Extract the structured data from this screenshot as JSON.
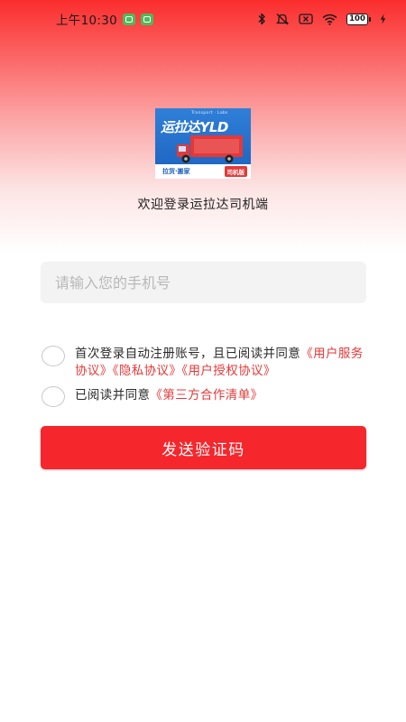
{
  "status_bar": {
    "time": "上午10:30",
    "battery": "100"
  },
  "logo": {
    "title": "运拉达YLD",
    "subtitle": "Transport · Labs",
    "bottom_text": "拉货·搬家",
    "badge": "司机版"
  },
  "welcome_text": "欢迎登录运拉达司机端",
  "phone_input": {
    "placeholder": "请输入您的手机号",
    "value": ""
  },
  "agreement1": {
    "text": "首次登录自动注册账号，且已阅读并同意",
    "link_user_service": "《用户服务协议》",
    "link_privacy": "《隐私协议》",
    "link_auth": "《用户授权协议》"
  },
  "agreement2": {
    "text": "已阅读并同意",
    "link_third_party": "《第三方合作清单》"
  },
  "send_code_button": "发送验证码",
  "colors": {
    "brand_red": "#f5262c",
    "link_red": "#e53838",
    "input_bg": "#f3f3f3"
  }
}
